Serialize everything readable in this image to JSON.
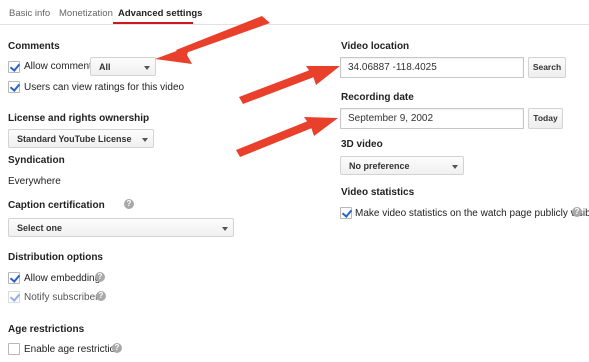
{
  "tabs": [
    {
      "label": "Basic info",
      "active": false
    },
    {
      "label": "Monetization",
      "active": false
    },
    {
      "label": "Advanced settings",
      "active": true
    }
  ],
  "comments": {
    "heading": "Comments",
    "allow_comments_label": "Allow comments",
    "allow_comments_checked": true,
    "filter_value": "All",
    "ratings_label": "Users can view ratings for this video",
    "ratings_checked": true
  },
  "license": {
    "heading": "License and rights ownership",
    "value": "Standard YouTube License"
  },
  "syndication": {
    "heading": "Syndication",
    "value": "Everywhere"
  },
  "caption": {
    "heading": "Caption certification",
    "value": "Select one"
  },
  "distribution": {
    "heading": "Distribution options",
    "embedding_label": "Allow embedding",
    "embedding_checked": true,
    "notify_label": "Notify subscribers",
    "notify_checked": true
  },
  "age": {
    "heading": "Age restrictions",
    "enable_label": "Enable age restriction",
    "enable_checked": false
  },
  "video_location": {
    "heading": "Video location",
    "value": "34.06887 -118.4025",
    "button": "Search"
  },
  "recording_date": {
    "heading": "Recording date",
    "value": "September  9, 2002",
    "button": "Today"
  },
  "video_3d": {
    "heading": "3D video",
    "value": "No preference"
  },
  "statistics": {
    "heading": "Video statistics",
    "label": "Make video statistics on the watch page publicly visible",
    "checked": true
  },
  "colors": {
    "active_tab_underline": "#cc181e",
    "checkbox_check": "#2a62c6",
    "annotation_arrow": "#e8402a"
  },
  "icons": {
    "help": "question-mark-circle",
    "dropdown": "caret-down",
    "annotation": "red-arrow"
  }
}
